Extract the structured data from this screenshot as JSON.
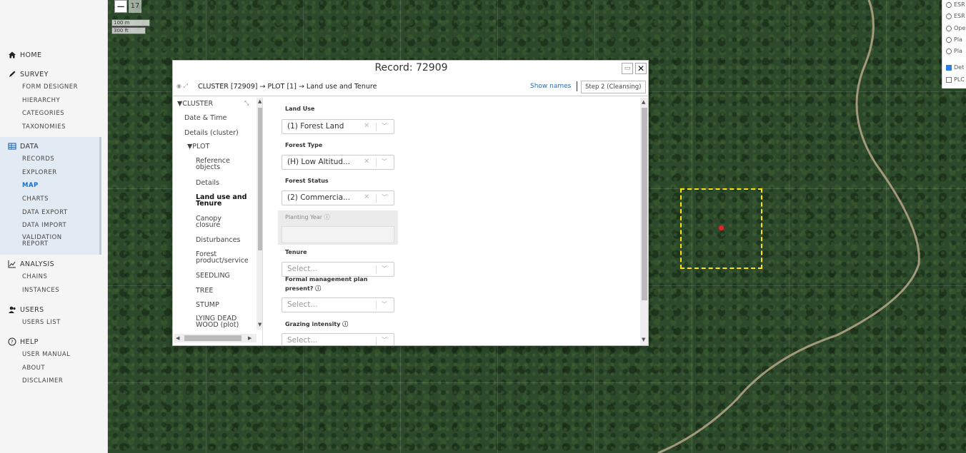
{
  "sidebar": {
    "home": "HOME",
    "survey": {
      "label": "SURVEY",
      "items": [
        "FORM DESIGNER",
        "HIERARCHY",
        "CATEGORIES",
        "TAXONOMIES"
      ]
    },
    "data": {
      "label": "DATA",
      "items": [
        "RECORDS",
        "EXPLORER",
        "MAP",
        "CHARTS",
        "DATA EXPORT",
        "DATA IMPORT",
        "VALIDATION REPORT"
      ],
      "current": "MAP"
    },
    "analysis": {
      "label": "ANALYSIS",
      "items": [
        "CHAINS",
        "INSTANCES"
      ]
    },
    "users": {
      "label": "USERS",
      "items": [
        "USERS LIST"
      ]
    },
    "help": {
      "label": "HELP",
      "items": [
        "USER MANUAL",
        "ABOUT",
        "DISCLAIMER"
      ]
    }
  },
  "map": {
    "zoom_out": "−",
    "zoom_level": "17",
    "scale_metric": "100 m",
    "scale_imperial": "300 ft",
    "plot_color": "#ffe600",
    "point_color": "#e8202a",
    "layers": [
      "ESR",
      "ESR",
      "Ope",
      "Pla",
      "Pla",
      "Det",
      "PLC"
    ]
  },
  "dialog": {
    "title": "Record: 72909",
    "breadcrumb": "CLUSTER [72909] → PLOT [1] → Land use and Tenure",
    "show_names": "Show names",
    "step": "Step 2 (Cleansing)",
    "tree": {
      "cluster": "▼CLUSTER",
      "date_time": "Date & Time",
      "details_cluster": "Details (cluster)",
      "plot": "▼PLOT",
      "reference_objects": [
        "Reference",
        "objects"
      ],
      "details": "Details",
      "land_use": [
        "Land use and",
        "Tenure"
      ],
      "canopy": [
        "Canopy",
        "closure"
      ],
      "disturbances": "Disturbances",
      "forest_product": [
        "Forest",
        "product/service"
      ],
      "seedling": "SEEDLING",
      "tree": "TREE",
      "stump": "STUMP",
      "lying_dead": [
        "LYING DEAD",
        "WOOD (plot)"
      ]
    },
    "form": {
      "land_use": {
        "label": "Land Use",
        "value": "(1) Forest Land"
      },
      "forest_type": {
        "label": "Forest Type",
        "value": "(H) Low Altitud..."
      },
      "forest_status": {
        "label": "Forest Status",
        "value": "(2) Commercia..."
      },
      "planting_year": {
        "label": "Planting Year ⓘ"
      },
      "tenure": {
        "label": "Tenure",
        "placeholder": "Select..."
      },
      "mgmt_plan": {
        "label1": "Formal management plan",
        "label2": "present? ⓘ",
        "placeholder": "Select..."
      },
      "grazing": {
        "label": "Grazing intensity ⓘ",
        "placeholder": "Select..."
      }
    }
  }
}
